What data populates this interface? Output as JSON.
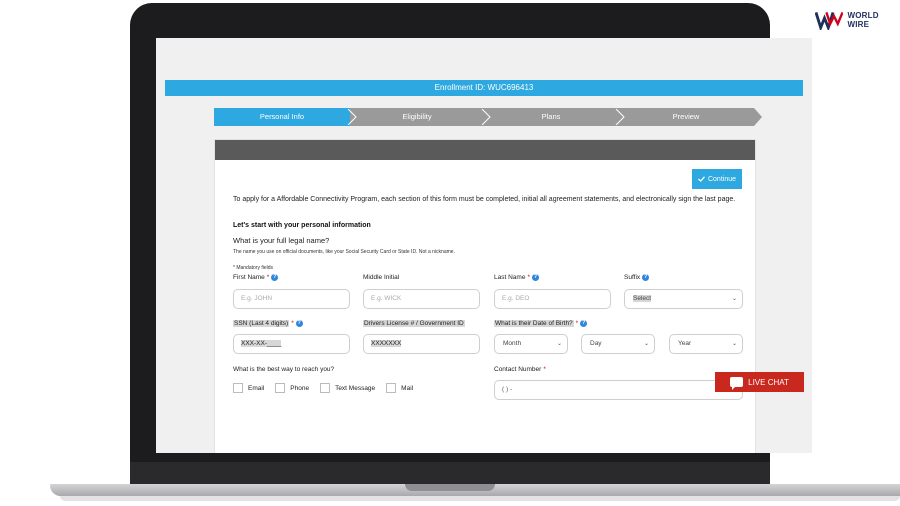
{
  "brand": {
    "name": "WORLD WIRE"
  },
  "enrollment": {
    "text": "Enrollment ID: WUC696413"
  },
  "steps": [
    {
      "label": "Personal Info",
      "active": true
    },
    {
      "label": "Eligibility",
      "active": false
    },
    {
      "label": "Plans",
      "active": false
    },
    {
      "label": "Preview",
      "active": false
    }
  ],
  "form": {
    "continue_label": "Continue",
    "intro": "To apply for a Affordable Connectivity Program, each section of this form must be completed, initial all agreement statements, and electronically sign the last page.",
    "section_title": "Let's start with your personal information",
    "question": "What is your full legal name?",
    "hint": "The name you use on official documents, like your Social Security Card or State ID. Not a nickname.",
    "mandatory_note": "* Mandatory fields",
    "first_name": {
      "label": "First Name",
      "placeholder": "E.g. JOHN"
    },
    "middle_initial": {
      "label": "Middle Initial",
      "placeholder": "E.g. WICK"
    },
    "last_name": {
      "label": "Last Name",
      "placeholder": "E.g. DEO"
    },
    "suffix": {
      "label": "Suffix",
      "value": "Select"
    },
    "ssn": {
      "label": "SSN (Last 4 digits)",
      "value": "XXX-XX-____"
    },
    "license": {
      "label": "Drivers License # / Government ID",
      "value": "XXXXXXX"
    },
    "dob": {
      "label": "What is their Date of Birth?",
      "month": "Month",
      "day": "Day",
      "year": "Year"
    },
    "contact_question": "What is the best way to reach you?",
    "contact_methods": [
      "Email",
      "Phone",
      "Text Message",
      "Mail"
    ],
    "contact_number": {
      "label": "Contact Number",
      "placeholder": "(   )   -"
    }
  },
  "live_chat": {
    "label": "LIVE CHAT"
  },
  "colors": {
    "accent": "#2ea8e0",
    "inactive_step": "#9a9a9a",
    "header_bar": "#5a5a5a",
    "live_chat": "#c8281e",
    "help": "#2e86de"
  },
  "icons": {
    "continue": "check-icon",
    "help": "question-circle-icon",
    "chat": "chat-bubble-icon",
    "dropdown": "chevron-down-icon"
  }
}
